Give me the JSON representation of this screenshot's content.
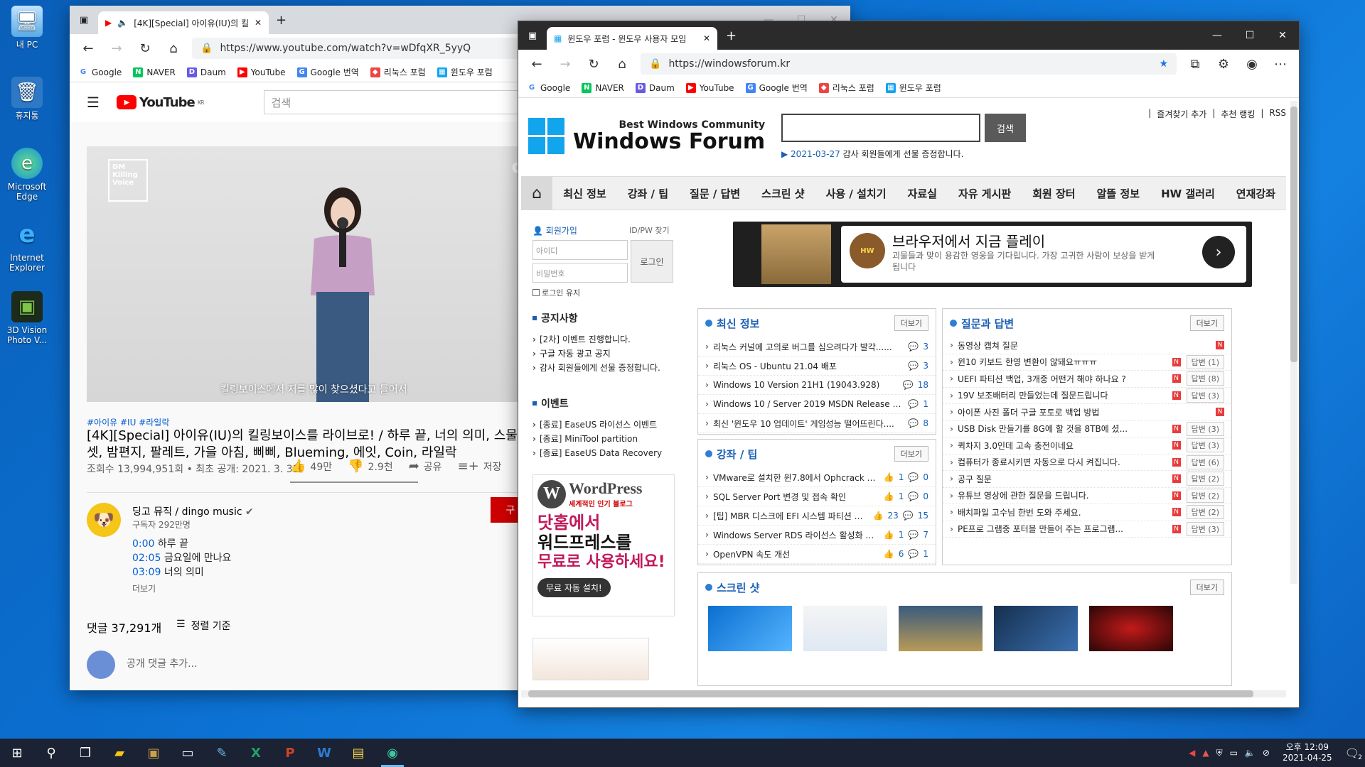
{
  "desktop": {
    "icons": [
      {
        "label": "내 PC"
      },
      {
        "label": "휴지통"
      },
      {
        "label": "Microsoft Edge"
      },
      {
        "label": "Internet Explorer"
      },
      {
        "label": "3D Vision Photo V..."
      }
    ]
  },
  "youtube_window": {
    "tab_title": "[4K][Special] 아이유(IU)의 킬",
    "url": "https://www.youtube.com/watch?v=wDfqXR_5yyQ",
    "favorites": [
      "Google",
      "NAVER",
      "Daum",
      "YouTube",
      "Google 번역",
      "리눅스 포럼",
      "윈도우 포럼"
    ],
    "logo_text": "YouTube",
    "logo_region": "KR",
    "search_placeholder": "검색",
    "video_caption": "킬링보이스에서 저를 많이 찾으셨다고 들어서",
    "video_brand": "dingo",
    "hashtags": "#아이유 #IU #라일락",
    "title": "[4K][Special] 아이유(IU)의 킬링보이스를 라이브로! / 하루 끝, 너의 의미, 스물셋, 밤편지, 팔레트, 가을 아침, 삐삐, Blueming, 에잇, Coin, 라일락",
    "views": "조회수 13,994,951회 • 최초 공개: 2021. 3. 31.",
    "likes": "49만",
    "dislikes": "2.9천",
    "share": "공유",
    "save": "저장",
    "channel_name": "딩고 뮤직 / dingo music",
    "subscribers": "구독자 292만명",
    "subscribe": "구",
    "chapters": [
      {
        "time": "0:00",
        "title": "하루 끝"
      },
      {
        "time": "02:05",
        "title": "금요일에 만나요"
      },
      {
        "time": "03:09",
        "title": "너의 의미"
      }
    ],
    "more": "더보기",
    "comments_count": "댓글 37,291개",
    "sort": "정렬 기준",
    "add_comment": "공개 댓글 추가..."
  },
  "edge_window": {
    "tab_title": "윈도우 포럼 - 윈도우 사용자 모임",
    "url": "https://windowsforum.kr",
    "favorites": [
      "Google",
      "NAVER",
      "Daum",
      "YouTube",
      "Google 번역",
      "리눅스 포럼",
      "윈도우 포럼"
    ],
    "site": {
      "tagline": "Best Windows Community",
      "name": "Windows Forum",
      "search_button": "검색",
      "notice_date": "2021-03-27",
      "notice_text": "감사 회원들에게 선물 증정합니다.",
      "top_links": [
        "즐겨찾기 추가",
        "추천 랭킹",
        "RSS"
      ],
      "nav": [
        "최신 정보",
        "강좌 / 팁",
        "질문 / 답변",
        "스크린 샷",
        "사용 / 설치기",
        "자료실",
        "자유 게시판",
        "회원 장터",
        "알뜰 정보",
        "HW 갤러리",
        "연재강좌"
      ],
      "login": {
        "join": "회원가입",
        "find": "ID/PW 찾기",
        "id_placeholder": "아이디",
        "pw_placeholder": "비밀번호",
        "login_button": "로그인",
        "keep": "로그인 유지"
      },
      "notices_title": "공지사항",
      "notices": [
        "[2차] 이벤트 진행합니다.",
        "구글 자동 광고 공지",
        "감사 회원들에게 선물 증정합니다."
      ],
      "events_title": "이벤트",
      "events": [
        "[종료] EaseUS 라이선스 이벤트",
        "[종료] MiniTool partition",
        "[종료] EaseUS Data Recovery"
      ],
      "ad_banner": {
        "title": "브라우저에서 지금 플레이",
        "desc": "괴물들과 맞이 용감한 영웅을 기다립니다. 가장 고귀한 사람이 보상을 받게 됩니다"
      },
      "wp_ad": {
        "brand": "WordPress",
        "sub": "세계적인 인기 블로그",
        "line1": "닷홈에서",
        "line2": "워드프레스를",
        "line3": "무료로 사용하세요!",
        "button": "무료 자동 설치!"
      },
      "more_label": "더보기",
      "latest": {
        "title": "최신 정보",
        "items": [
          {
            "t": "리눅스 커널에 고의로 버그를 심으려다가 발각......",
            "c": "3"
          },
          {
            "t": "리눅스 OS - Ubuntu 21.04 배포",
            "c": "3"
          },
          {
            "t": "Windows 10 Version 21H1 (19043.928)",
            "c": "18"
          },
          {
            "t": "Windows 10 / Server 2019 MSDN Release (2021-04...",
            "c": "1"
          },
          {
            "t": "최신 '윈도우 10 업데이트' 게임성능 떨어뜨린다....",
            "c": "8"
          }
        ]
      },
      "tips": {
        "title": "강좌 / 팁",
        "items": [
          {
            "t": "VMware로 설치한 윈7.8에서 Ophcrack 안돌려...",
            "l": "1",
            "c": "0"
          },
          {
            "t": "SQL Server Port 변경 및 접속 확인",
            "l": "1",
            "c": "0"
          },
          {
            "t": "[팁] MBR 디스크에 EFI 시스템 파티션 만들기",
            "l": "23",
            "c": "15"
          },
          {
            "t": "Windows Server RDS 라이선스 활성화 및 구성",
            "l": "1",
            "c": "7"
          },
          {
            "t": "OpenVPN 속도 개선",
            "l": "6",
            "c": "1"
          }
        ]
      },
      "qna": {
        "title": "질문과 답변",
        "items": [
          {
            "t": "동영상 캡쳐 질문",
            "a": ""
          },
          {
            "t": "윈10 키보드 한영 변환이 않돼요ㅠㅠㅠ",
            "a": "답변 (1)"
          },
          {
            "t": "UEFI 파티션 백업, 3개중 어떤거 해야 하나요 ?",
            "a": "답변 (8)"
          },
          {
            "t": "19V 보조배터리 만들었는데 질문드립니다",
            "a": "답변 (3)"
          },
          {
            "t": "아이폰 사진 폴더 구글 포토로 백업 방법",
            "a": ""
          },
          {
            "t": "USB Disk 만들기를 8G에 할 것을 8TB에 셨...",
            "a": "답변 (3)"
          },
          {
            "t": "퀵차지 3.0인데 고속 충전이네요",
            "a": "답변 (3)"
          },
          {
            "t": "컴퓨터가 종료시키면 자동으로 다시 켜집니다.",
            "a": "답변 (6)"
          },
          {
            "t": "공구 질문",
            "a": "답변 (2)"
          },
          {
            "t": "유튜브 영상에 관한 질문을 드립니다.",
            "a": "답변 (2)"
          },
          {
            "t": "배치파일 고수님 한번 도와 주세요.",
            "a": "답변 (2)"
          },
          {
            "t": "PE프로 그램중 포터블 만들어 주는 프로그램...",
            "a": "답변 (3)"
          }
        ]
      },
      "screenshots": {
        "title": "스크린 샷"
      }
    }
  },
  "taskbar": {
    "clock_time": "오후 12:09",
    "clock_date": "2021-04-25",
    "notif_count": "2"
  },
  "colors": {
    "accent": "#1a5fb4",
    "youtube_red": "#ff0000"
  }
}
